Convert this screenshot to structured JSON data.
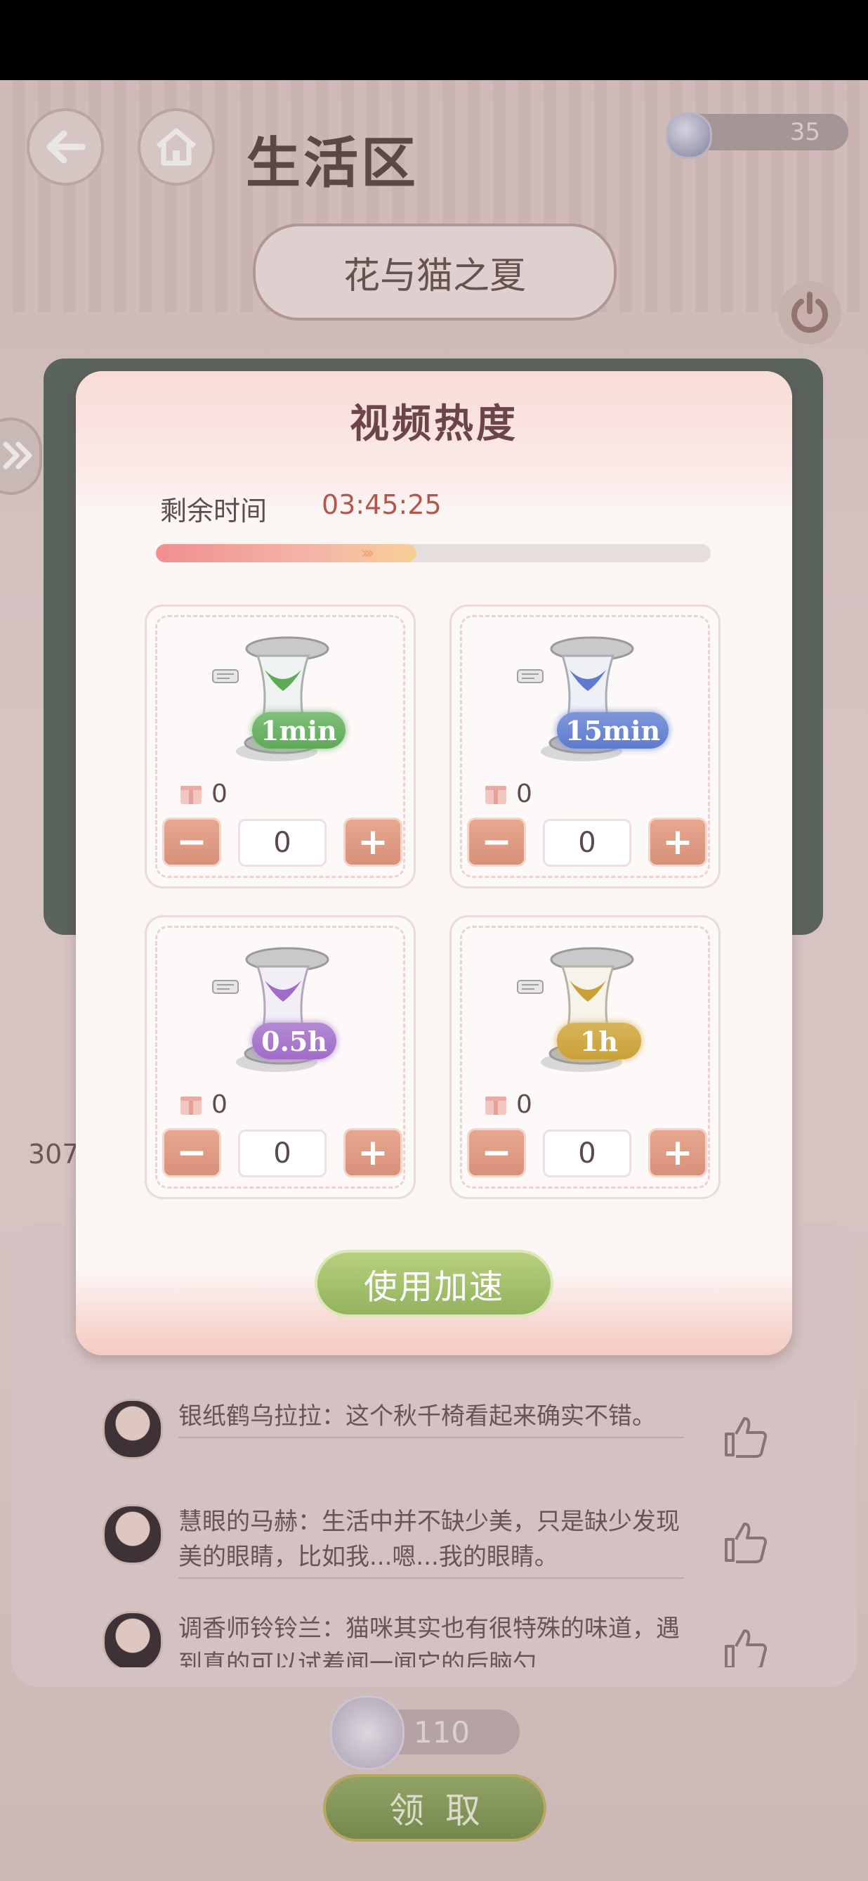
{
  "background": {
    "title": "生活区",
    "coin_amount": "35",
    "video_title": "花与猫之夏",
    "like_count": "307",
    "comments": [
      {
        "text": "银纸鹤乌拉拉：这个秋千椅看起来确实不错。"
      },
      {
        "text": "慧眼的马赫：生活中并不缺少美，只是缺少发现美的眼睛，比如我...嗯...我的眼睛。"
      },
      {
        "text": "调香师铃铃兰：猫咪其实也有很特殊的味道，遇到真的可以试着闻一闻它的后脑勺"
      }
    ],
    "reward_amount": "110",
    "claim_label": "领取"
  },
  "modal": {
    "title": "视频热度",
    "time_label": "剩余时间",
    "time_value": "03:45:25",
    "progress_fraction": 0.47,
    "cards": [
      {
        "duration": "1min",
        "owned": "0",
        "selected": "0",
        "color": "#7fbf7a",
        "sand": "#5faa59"
      },
      {
        "duration": "15min",
        "owned": "0",
        "selected": "0",
        "color": "#7f97da",
        "sand": "#5f7bd0"
      },
      {
        "duration": "0.5h",
        "owned": "0",
        "selected": "0",
        "color": "#b48ad4",
        "sand": "#a06cc8"
      },
      {
        "duration": "1h",
        "owned": "0",
        "selected": "0",
        "color": "#d8b45a",
        "sand": "#c9a138"
      }
    ],
    "minus_label": "−",
    "plus_label": "+",
    "use_button": "使用加速"
  }
}
